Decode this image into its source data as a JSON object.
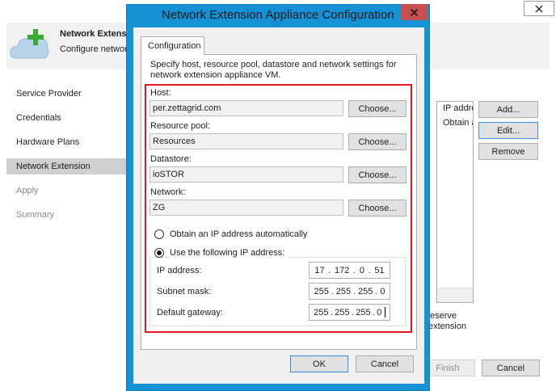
{
  "wizard": {
    "header": {
      "title": "Network Extension",
      "subtitle": "Configure network extension"
    },
    "nav": [
      {
        "label": "Service Provider",
        "state": "done"
      },
      {
        "label": "Credentials",
        "state": "done"
      },
      {
        "label": "Hardware Plans",
        "state": "done"
      },
      {
        "label": "Network Extension",
        "state": "active"
      },
      {
        "label": "Apply",
        "state": "disabled"
      },
      {
        "label": "Summary",
        "state": "disabled"
      }
    ],
    "table": {
      "header": "IP addre",
      "rows": [
        "Obtain a"
      ]
    },
    "side_buttons": {
      "add": "Add...",
      "edit": "Edit...",
      "remove": "Remove"
    },
    "note": {
      "line1": "eserve",
      "line2": "extension"
    },
    "footer_buttons": {
      "finish": "Finish",
      "cancel": "Cancel"
    }
  },
  "dialog": {
    "title": "Network Extension Appliance Configuration",
    "tab": "Configuration",
    "description": "Specify host, resource pool, datastore and network settings for network extension appliance VM.",
    "fields": [
      {
        "label": "Host:",
        "value": "per.zettagrid.com",
        "button": "Choose..."
      },
      {
        "label": "Resource pool:",
        "value": "Resources",
        "button": "Choose..."
      },
      {
        "label": "Datastore:",
        "value": "ioSTOR",
        "button": "Choose..."
      },
      {
        "label": "Network:",
        "value": "ZG",
        "button": "Choose..."
      }
    ],
    "ip_mode": {
      "auto_label": "Obtain an IP address automatically",
      "manual_label": "Use the following IP address:",
      "selected": "manual"
    },
    "ip": {
      "address_label": "IP address:",
      "address": [
        "17",
        "172",
        "0",
        "51"
      ],
      "mask_label": "Subnet mask:",
      "mask": [
        "255",
        "255",
        "255",
        "0"
      ],
      "gateway_label": "Default gateway:",
      "gateway": [
        "255",
        "255",
        "255",
        "0"
      ]
    },
    "buttons": {
      "ok": "OK",
      "cancel": "Cancel"
    }
  },
  "colors": {
    "dialog_frame": "#1592d5",
    "close_button": "#c74f4f",
    "highlight_frame": "#e3171e",
    "active_nav": "#cfcfcf",
    "cloud_icon": "#b8d4ea",
    "plus_icon": "#3aaa35"
  },
  "icons": {
    "header": "cloud-plus-icon",
    "close": "close-icon"
  }
}
